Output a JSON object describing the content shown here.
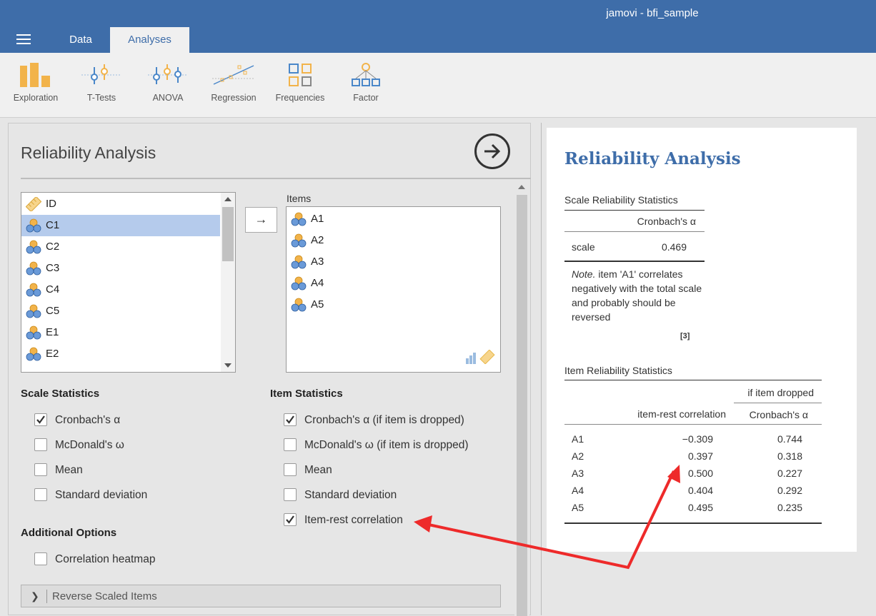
{
  "window": {
    "title": "jamovi - bfi_sample"
  },
  "tabs": [
    {
      "label": "Data"
    },
    {
      "label": "Analyses"
    }
  ],
  "ribbon": [
    {
      "label": "Exploration",
      "icon": "exploration-icon"
    },
    {
      "label": "T-Tests",
      "icon": "t-tests-icon"
    },
    {
      "label": "ANOVA",
      "icon": "anova-icon"
    },
    {
      "label": "Regression",
      "icon": "regression-icon"
    },
    {
      "label": "Frequencies",
      "icon": "frequencies-icon"
    },
    {
      "label": "Factor",
      "icon": "factor-icon"
    }
  ],
  "options_panel": {
    "title": "Reliability Analysis",
    "move_arrow": "→",
    "variables": [
      {
        "name": "ID",
        "type": "id",
        "selected": false
      },
      {
        "name": "C1",
        "type": "ordinal",
        "selected": true
      },
      {
        "name": "C2",
        "type": "ordinal",
        "selected": false
      },
      {
        "name": "C3",
        "type": "ordinal",
        "selected": false
      },
      {
        "name": "C4",
        "type": "ordinal",
        "selected": false
      },
      {
        "name": "C5",
        "type": "ordinal",
        "selected": false
      },
      {
        "name": "E1",
        "type": "ordinal",
        "selected": false
      },
      {
        "name": "E2",
        "type": "ordinal",
        "selected": false
      }
    ],
    "items_label": "Items",
    "items": [
      "A1",
      "A2",
      "A3",
      "A4",
      "A5"
    ],
    "scale_statistics": {
      "title": "Scale Statistics",
      "options": [
        {
          "label": "Cronbach's α",
          "checked": true
        },
        {
          "label": "McDonald's ω",
          "checked": false
        },
        {
          "label": "Mean",
          "checked": false
        },
        {
          "label": "Standard deviation",
          "checked": false
        }
      ]
    },
    "item_statistics": {
      "title": "Item Statistics",
      "options": [
        {
          "label": "Cronbach's α (if item is dropped)",
          "checked": true
        },
        {
          "label": "McDonald's ω (if item is dropped)",
          "checked": false
        },
        {
          "label": "Mean",
          "checked": false
        },
        {
          "label": "Standard deviation",
          "checked": false
        },
        {
          "label": "Item-rest correlation",
          "checked": true
        }
      ]
    },
    "additional_options": {
      "title": "Additional Options",
      "options": [
        {
          "label": "Correlation heatmap",
          "checked": false
        }
      ]
    },
    "reverse_scaled": {
      "chevron": "❯",
      "label": "Reverse Scaled Items"
    }
  },
  "results": {
    "title": "Reliability Analysis",
    "scale_table": {
      "title": "Scale Reliability Statistics",
      "header": "Cronbach's α",
      "row_label": "scale",
      "value": "0.469",
      "note_prefix": "Note.",
      "note_text": " item 'A1' correlates negatively with the total scale and probably should be reversed",
      "ref": "[3]"
    },
    "item_table": {
      "title": "Item Reliability Statistics",
      "group_header": "if item dropped",
      "col_item_rest": "item-rest correlation",
      "col_alpha": "Cronbach's α",
      "rows": [
        {
          "item": "A1",
          "item_rest": "−0.309",
          "alpha": "0.744"
        },
        {
          "item": "A2",
          "item_rest": "0.397",
          "alpha": "0.318"
        },
        {
          "item": "A3",
          "item_rest": "0.500",
          "alpha": "0.227"
        },
        {
          "item": "A4",
          "item_rest": "0.404",
          "alpha": "0.292"
        },
        {
          "item": "A5",
          "item_rest": "0.495",
          "alpha": "0.235"
        }
      ]
    }
  },
  "colors": {
    "brand": "#3e6da9",
    "selection": "#b5cbec",
    "annotation": "#ee2a2a"
  }
}
